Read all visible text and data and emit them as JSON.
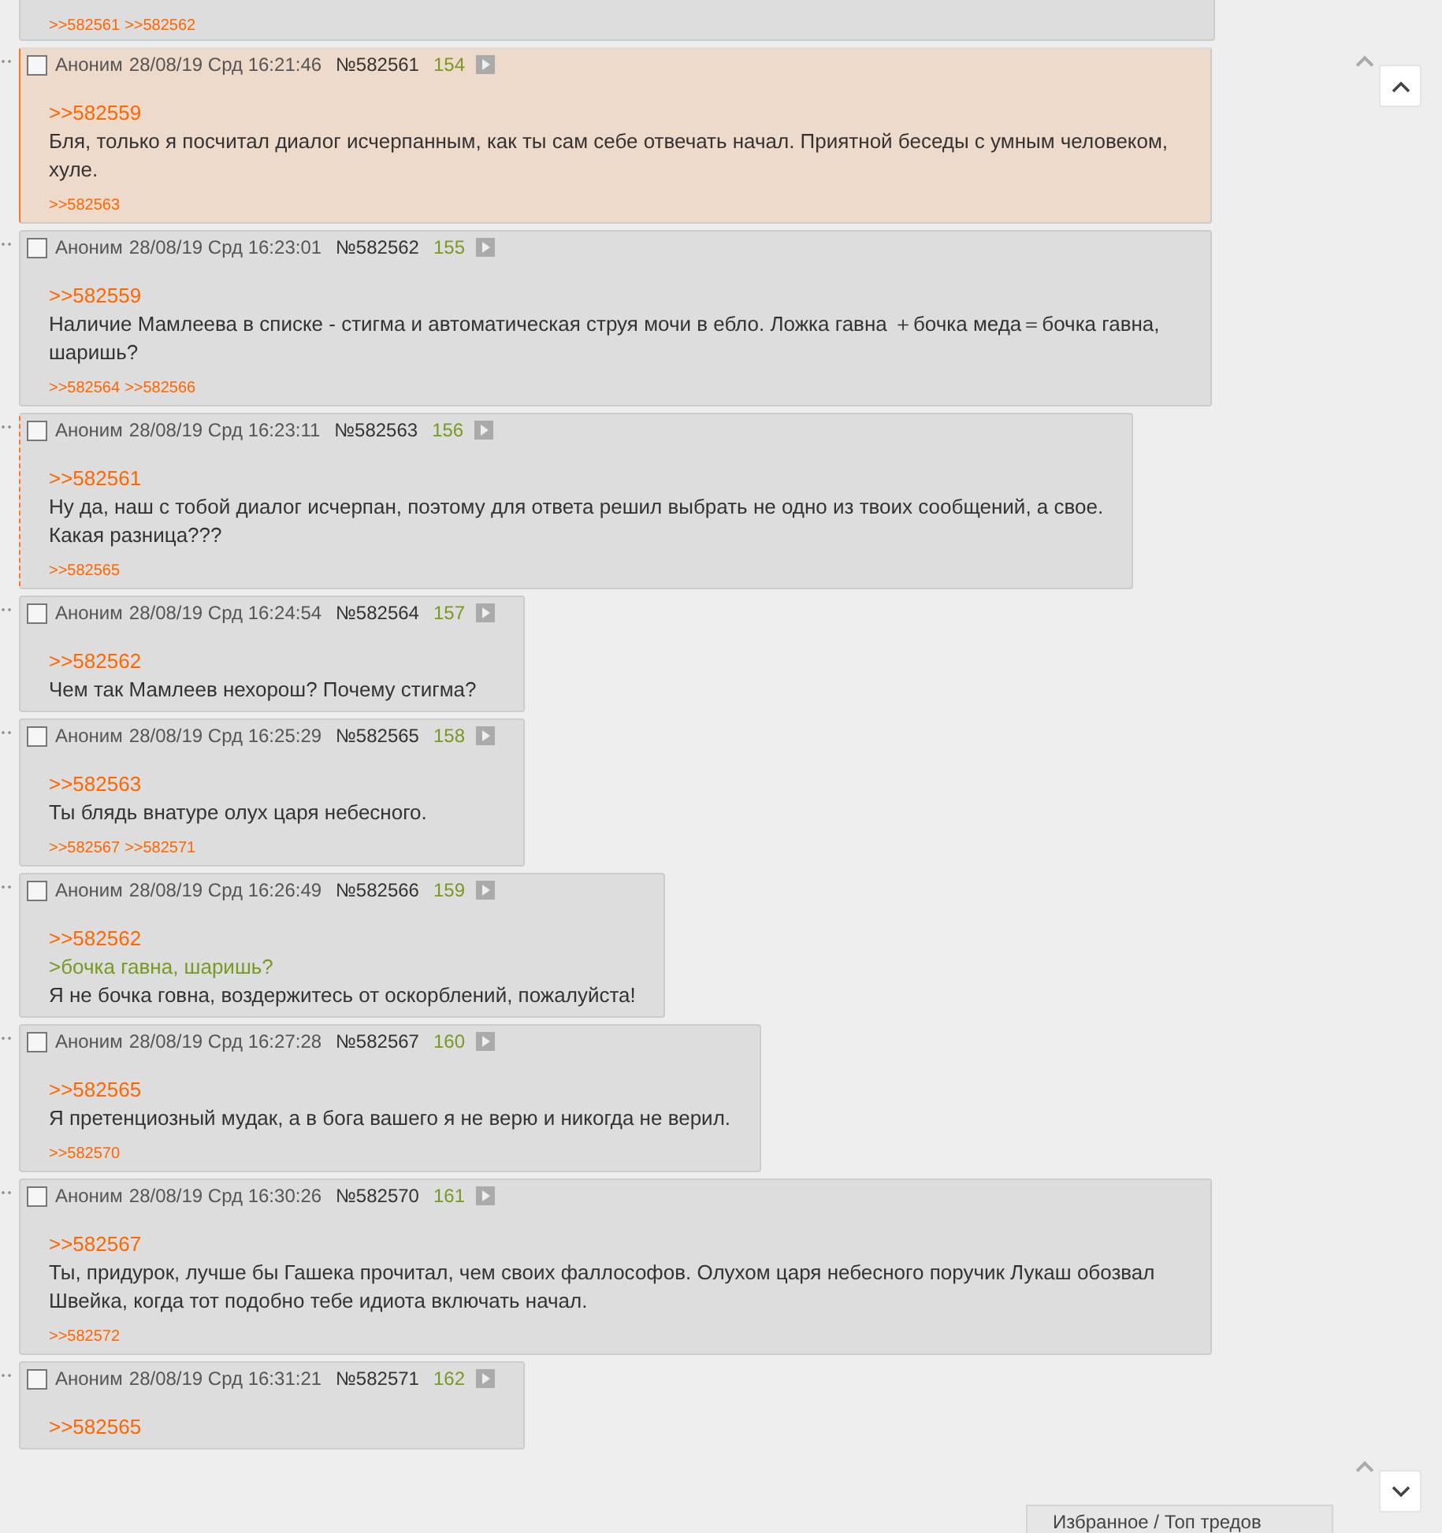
{
  "top_fragment": {
    "replies": [
      ">>582561",
      ">>582562"
    ]
  },
  "posts": [
    {
      "kind": "highlighted",
      "checked": false,
      "name": "Аноним",
      "date": "28/08/19 Срд 16:21:46",
      "number": "№582561",
      "count": "154",
      "body": [
        {
          "kind": "reply",
          "text": ">>582559"
        },
        {
          "kind": "text",
          "text": "Бля, только я посчитал диалог исчерпанным, как ты сам себе отвечать начал. Приятной беседы с умным человеком, хуле."
        }
      ],
      "replies": [
        ">>582563"
      ]
    },
    {
      "kind": "plain",
      "checked": false,
      "name": "Аноним",
      "date": "28/08/19 Срд 16:23:01",
      "number": "№582562",
      "count": "155",
      "body": [
        {
          "kind": "reply",
          "text": ">>582559"
        },
        {
          "kind": "text",
          "text": "Наличие Мамлеева в списке - стигма и автоматическая струя мочи в ебло. Ложка гавна ＋бочка меда＝бочка гавна, шаришь?"
        }
      ],
      "replies": [
        ">>582564",
        ">>582566"
      ]
    },
    {
      "kind": "linked",
      "checked": false,
      "name": "Аноним",
      "date": "28/08/19 Срд 16:23:11",
      "number": "№582563",
      "count": "156",
      "body": [
        {
          "kind": "reply",
          "text": ">>582561"
        },
        {
          "kind": "text",
          "text": "Ну да, наш с тобой диалог исчерпан, поэтому для ответа решил выбрать не одно из твоих сообщений, а свое."
        },
        {
          "kind": "text",
          "text": "Какая разница???"
        }
      ],
      "replies": [
        ">>582565"
      ]
    },
    {
      "kind": "plain",
      "checked": false,
      "name": "Аноним",
      "date": "28/08/19 Срд 16:24:54",
      "number": "№582564",
      "count": "157",
      "body": [
        {
          "kind": "reply",
          "text": ">>582562"
        },
        {
          "kind": "text",
          "text": "Чем так Мамлеев нехорош? Почему стигма?"
        }
      ]
    },
    {
      "kind": "plain",
      "checked": false,
      "name": "Аноним",
      "date": "28/08/19 Срд 16:25:29",
      "number": "№582565",
      "count": "158",
      "body": [
        {
          "kind": "reply",
          "text": ">>582563"
        },
        {
          "kind": "text",
          "text": "Ты блядь внатуре олух царя небесного."
        }
      ],
      "replies": [
        ">>582567",
        ">>582571"
      ]
    },
    {
      "kind": "plain",
      "checked": false,
      "name": "Аноним",
      "date": "28/08/19 Срд 16:26:49",
      "number": "№582566",
      "count": "159",
      "body": [
        {
          "kind": "reply",
          "text": ">>582562"
        },
        {
          "kind": "quote",
          "text": ">бочка гавна, шаришь?"
        },
        {
          "kind": "text",
          "text": "Я не бочка говна, воздержитесь от оскорблений, пожалуйста!"
        }
      ]
    },
    {
      "kind": "plain",
      "checked": false,
      "name": "Аноним",
      "date": "28/08/19 Срд 16:27:28",
      "number": "№582567",
      "count": "160",
      "body": [
        {
          "kind": "reply",
          "text": ">>582565"
        },
        {
          "kind": "text",
          "text": "Я претенциозный мудак, а в бога вашего я не верю и никогда не верил."
        }
      ],
      "replies": [
        ">>582570"
      ]
    },
    {
      "kind": "plain",
      "checked": false,
      "name": "Аноним",
      "date": "28/08/19 Срд 16:30:26",
      "number": "№582570",
      "count": "161",
      "body": [
        {
          "kind": "reply",
          "text": ">>582567"
        },
        {
          "kind": "text",
          "text": "Ты, придурок, лучше бы Гашека прочитал, чем своих фаллософов. Олухом царя небесного поручик Лукаш обозвал Швейка, когда тот подобно тебе идиота включать начал."
        }
      ],
      "replies": [
        ">>582572"
      ]
    },
    {
      "kind": "plain",
      "checked": false,
      "name": "Аноним",
      "date": "28/08/19 Срд 16:31:21",
      "number": "№582571",
      "count": "162",
      "body": [
        {
          "kind": "reply",
          "text": ">>582565"
        }
      ]
    }
  ],
  "favorites_panel": {
    "label": "Избранное / Топ тредов"
  }
}
